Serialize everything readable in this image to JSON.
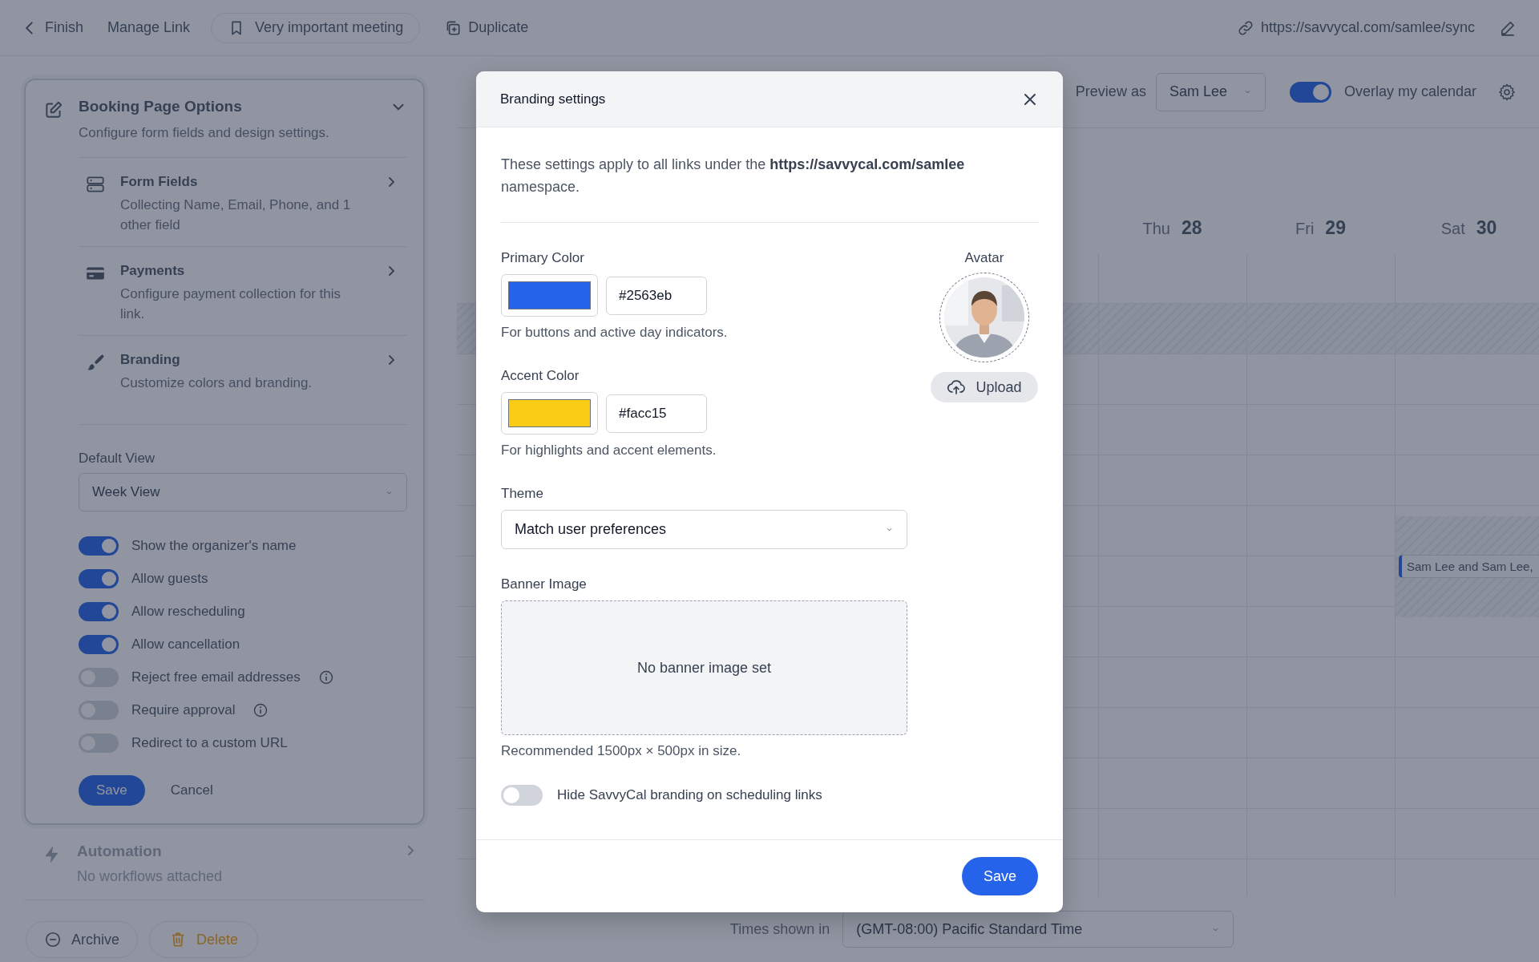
{
  "top_bar": {
    "back": "Finish",
    "manage": "Manage Link",
    "meeting": "Very important meeting",
    "duplicate": "Duplicate",
    "url": "https://savvycal.com/samlee/sync"
  },
  "booking_options": {
    "title": "Booking Page Options",
    "subtitle": "Configure form fields and design settings.",
    "sections": [
      {
        "kind": "fields",
        "title": "Form Fields",
        "description": "Collecting Name, Email, Phone, and 1 other field"
      },
      {
        "kind": "payments",
        "title": "Payments",
        "description": "Configure payment collection for this link."
      },
      {
        "kind": "branding",
        "title": "Branding",
        "description": "Customize colors and branding."
      }
    ],
    "default_view": {
      "label": "Default View",
      "value": "Week View"
    },
    "toggles": [
      {
        "label": "Show the organizer's name",
        "on": true,
        "info": false
      },
      {
        "label": "Allow guests",
        "on": true,
        "info": false
      },
      {
        "label": "Allow rescheduling",
        "on": true,
        "info": false
      },
      {
        "label": "Allow cancellation",
        "on": true,
        "info": false
      },
      {
        "label": "Reject free email addresses",
        "on": false,
        "info": true
      },
      {
        "label": "Require approval",
        "on": false,
        "info": true
      },
      {
        "label": "Redirect to a custom URL",
        "on": false,
        "info": false
      }
    ],
    "save": "Save",
    "cancel": "Cancel"
  },
  "automation": {
    "title": "Automation",
    "description": "No workflows attached"
  },
  "footer_buttons": {
    "archive": "Archive",
    "delete": "Delete"
  },
  "calendar": {
    "preview_label": "Preview as",
    "preview_value": "Sam Lee",
    "overlay": {
      "label": "Overlay my calendar",
      "on": true
    },
    "days": [
      {
        "name": "Thu",
        "date": "28"
      },
      {
        "name": "Fri",
        "date": "29"
      },
      {
        "name": "Sat",
        "date": "30"
      }
    ],
    "event": "Sam Lee and Sam Lee,",
    "timezone_label": "Times shown in",
    "timezone": "(GMT-08:00) Pacific Standard Time"
  },
  "modal": {
    "title": "Branding settings",
    "intro": "These settings apply to all links under the **https://savvycal.com/samlee** namespace.",
    "colors": [
      {
        "label": "Primary Color",
        "color": "#2563eb",
        "value": "#2563eb",
        "hint": "For buttons and active day indicators."
      },
      {
        "label": "Accent Color",
        "color": "#facc15",
        "value": "#facc15",
        "hint": "For highlights and accent elements."
      }
    ],
    "avatar": {
      "label": "Avatar",
      "upload": "Upload"
    },
    "theme": {
      "label": "Theme",
      "value": "Match user preferences"
    },
    "banner": {
      "label": "Banner Image",
      "empty_text": "No banner image set",
      "hint": "Recommended 1500px × 500px in size."
    },
    "hide_branding": {
      "label": "Hide SavvyCal branding on scheduling links",
      "on": false
    },
    "save": "Save"
  }
}
